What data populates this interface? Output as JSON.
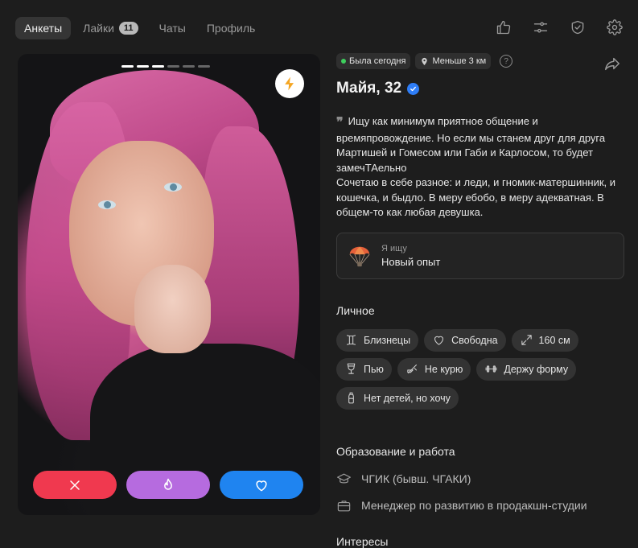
{
  "nav": {
    "tabs": [
      {
        "label": "Анкеты"
      },
      {
        "label": "Лайки",
        "badge": "11"
      },
      {
        "label": "Чаты"
      },
      {
        "label": "Профиль"
      }
    ],
    "icons": [
      "thumbs-up-icon",
      "sliders-icon",
      "shield-icon",
      "gear-icon"
    ]
  },
  "photo": {
    "pages_total": 6,
    "current_page": 3,
    "buttons": {
      "dislike_color": "#f0394f",
      "superlike_color": "#b66bdf",
      "like_color": "#1f84f0"
    }
  },
  "profile": {
    "status": "Была сегодня",
    "distance": "Меньше 3 км",
    "name": "Майя, 32",
    "bio": "Ищу как минимум приятное общение и времяпровождение. Но если мы станем друг для друга Мартишей и Гомесом или Габи и Карлосом, то будет замечТАельно\nСочетаю в себе разное: и леди, и гномик-матершинник, и кошечка, и быдло. В меру ебобо, в меру адекватная. В общем-то как любая девушка.",
    "seeking": {
      "label": "Я ищу",
      "value": "Новый опыт"
    },
    "personal_title": "Личное",
    "chips": [
      "Близнецы",
      "Свободна",
      "160 см",
      "Пью",
      "Не курю",
      "Держу форму",
      "Нет детей, но хочу"
    ],
    "education_title": "Образование и работа",
    "education": "ЧГИК (бывш. ЧГАКИ)",
    "job": "Менеджер по развитию в продакшн-студии",
    "interests_title": "Интересы"
  }
}
